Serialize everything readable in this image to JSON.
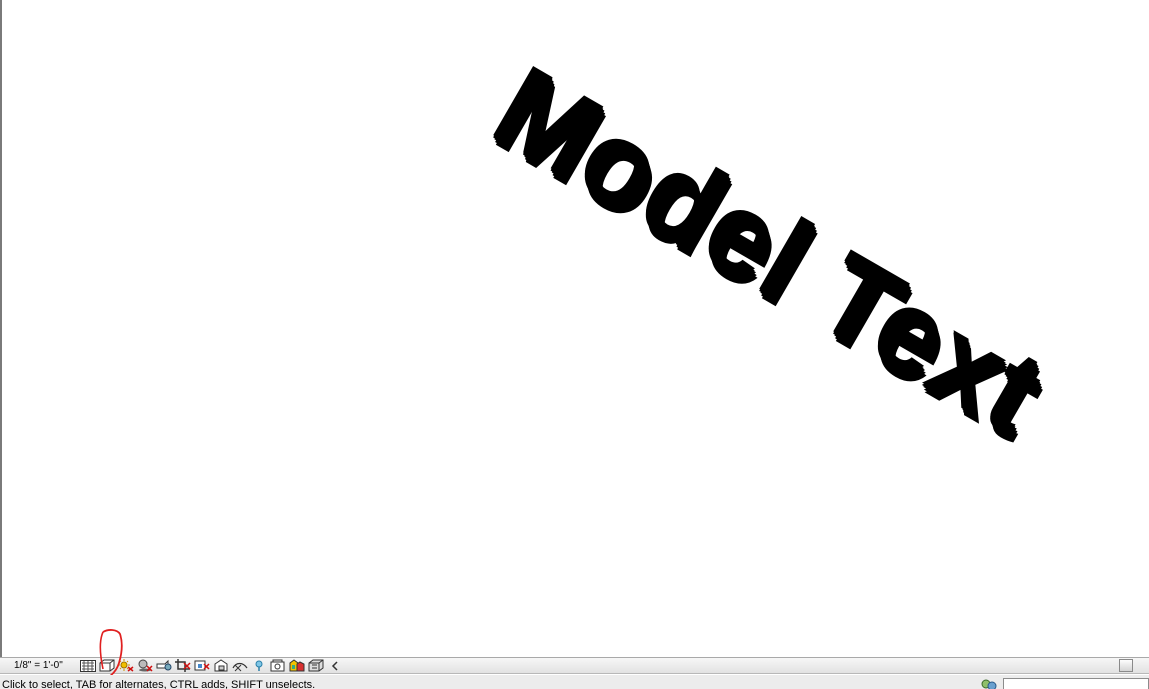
{
  "canvas": {
    "model_text": "Model Text"
  },
  "view_bar": {
    "scale": "1/8\" = 1'-0\"",
    "icons": [
      "detail-level-icon",
      "visual-style-icon",
      "sun-path-icon",
      "shadows-icon",
      "show-rendering-icon",
      "crop-view-icon",
      "show-crop-region-icon",
      "unlock-3d-view-icon",
      "temporary-hide-isolate-icon",
      "reveal-hidden-elements-icon",
      "temporary-view-properties-icon",
      "worksharing-display-icon",
      "analytical-model-icon"
    ],
    "highlight_color": "#e02020"
  },
  "status_bar": {
    "message": "Click to select, TAB for alternates, CTRL adds, SHIFT unselects."
  }
}
